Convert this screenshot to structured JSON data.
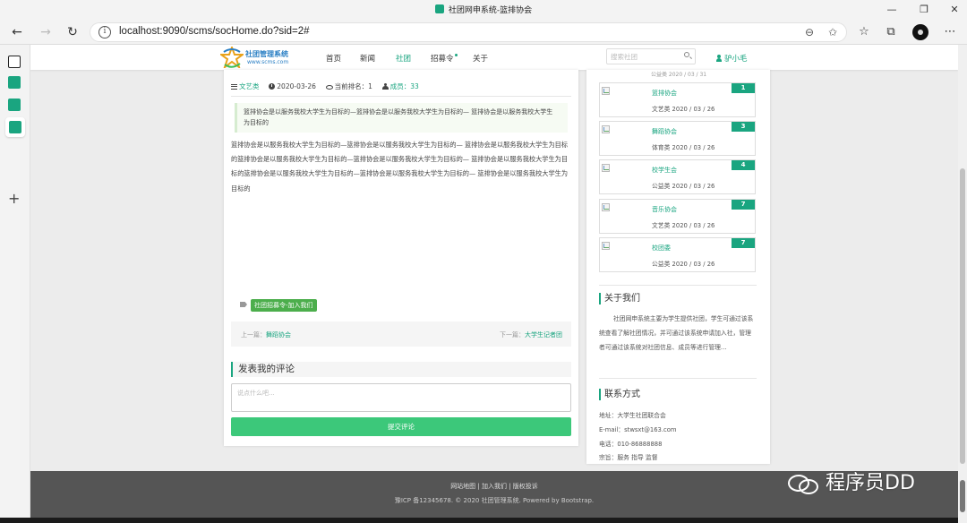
{
  "window": {
    "title": "社团网申系统-篮排协会"
  },
  "browser": {
    "url": "localhost:9090/scms/socHome.do?sid=2#"
  },
  "site": {
    "logo_title": "社团管理系统",
    "logo_sub": "www.scms.com",
    "nav": [
      "首页",
      "新闻",
      "社团",
      "招募令",
      "关于"
    ],
    "search_placeholder": "搜索社团",
    "username": "驴小毛"
  },
  "article": {
    "category": "文艺类",
    "date": "2020-03-26",
    "rank_label": "当前排名：1",
    "members_label": "成员：33",
    "summary": "篮排协会是以服务我校大学生为目标的—篮排协会是以服务我校大学生为目标的— 篮排协会是以服务我校大学生为目标的",
    "body": "篮排协会是以服务我校大学生为目标的—篮排协会是以服务我校大学生为目标的— 篮排协会是以服务我校大学生为目标的篮排协会是以服务我校大学生为目标的—篮排协会是以服务我校大学生为目标的— 篮排协会是以服务我校大学生为目标的篮排协会是以服务我校大学生为目标的—篮排协会是以服务我校大学生为目标的— 篮排协会是以服务我校大学生为目标的",
    "tag": "社团招募令-加入我们",
    "prev_label": "上一篇：",
    "prev_link": "舞蹈协会",
    "next_label": "下一篇：",
    "next_link": "大学生记者团"
  },
  "comment": {
    "title": "发表我的评论",
    "placeholder": "说点什么吧...",
    "submit": "提交评论"
  },
  "sidebar": {
    "top_partial": "公益类  2020 / 03 / 31",
    "items": [
      {
        "name": "篮排协会",
        "sub": "文艺类  2020 / 03 / 26",
        "badge": "1"
      },
      {
        "name": "舞蹈协会",
        "sub": "体育类  2020 / 03 / 26",
        "badge": "3"
      },
      {
        "name": "校学生会",
        "sub": "公益类  2020 / 03 / 26",
        "badge": "4"
      },
      {
        "name": "音乐协会",
        "sub": "文艺类  2020 / 03 / 26",
        "badge": "7"
      },
      {
        "name": "校团委",
        "sub": "公益类  2020 / 03 / 26",
        "badge": "7"
      }
    ],
    "about_title": "关于我们",
    "about_text": "社团网申系统主要为学生提供社团，学生可通过该系统查看了解社团情况，并可通过该系统申请加入社，管理者可通过该系统对社团信息、成员等进行管理...",
    "contact_title": "联系方式",
    "contact": {
      "address": "地址：大学生社团联合会",
      "email": "E-mail：stwsxt@163.com",
      "phone": "电话：010-86888888",
      "motto": "宗旨：服务 指导 监督"
    }
  },
  "footer": {
    "links": "网站地图 | 加入我们 | 版权投诉",
    "copyright": "豫ICP 备12345678. © 2020 社团管理系统. Powered by Bootstrap."
  },
  "watermark": "程序员DD"
}
